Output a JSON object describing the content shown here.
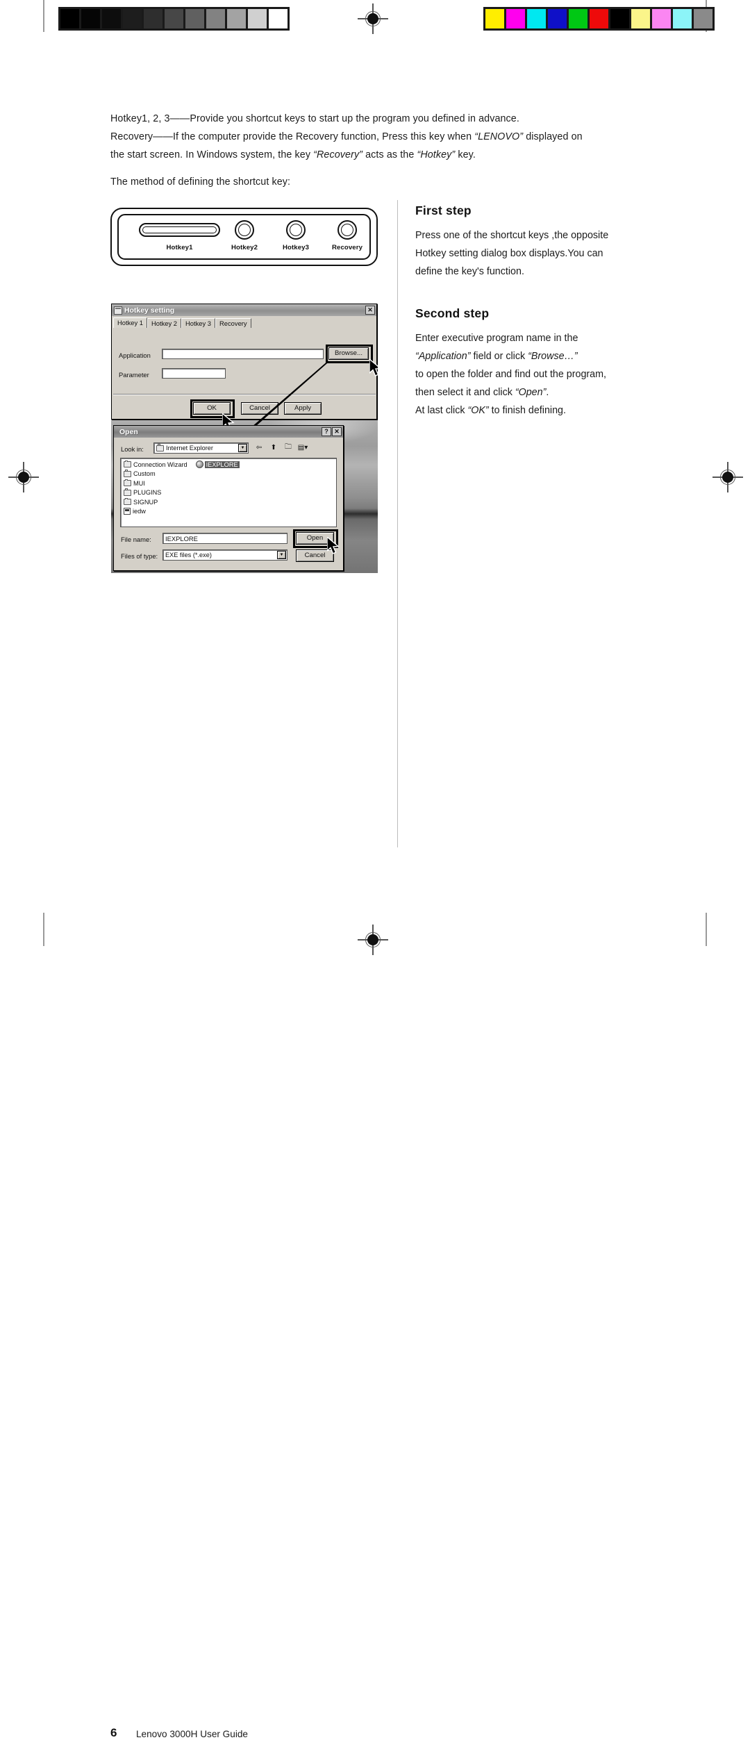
{
  "print_marks": {
    "grayscale_patches": [
      "#000000",
      "#050505",
      "#0d0d0d",
      "#1d1d1d",
      "#2e2e2e",
      "#474747",
      "#606060",
      "#828282",
      "#a3a3a3",
      "#d0d0d0",
      "#ffffff"
    ],
    "color_patches": [
      "#ffee00",
      "#ff00ee",
      "#00e8f0",
      "#0f10c8",
      "#00c814",
      "#ee0a0a",
      "#000000",
      "#fbf58a",
      "#fb86f2",
      "#8cf4f8",
      "#8a8a8a"
    ],
    "registration_mark_name": "registration-target"
  },
  "body": {
    "paragraph_1": "Hotkey1, 2, 3——Provide you shortcut keys to start up the program you defined in advance.",
    "paragraph_2_pre": "Recovery——If the computer provide the Recovery function, Press this key when ",
    "paragraph_2_em1": "“LENOVO”",
    "paragraph_2_mid": " displayed on",
    "paragraph_3_pre": "the start screen. In Windows system, the key ",
    "paragraph_3_em1": "“Recovery”",
    "paragraph_3_mid": " acts as the ",
    "paragraph_3_em2": "“Hotkey”",
    "paragraph_3_post": " key.",
    "paragraph_4": "The method of defining the shortcut key:"
  },
  "hotkey_panel": {
    "keys": [
      {
        "label": "Hotkey1",
        "shape": "long"
      },
      {
        "label": "Hotkey2",
        "shape": "round"
      },
      {
        "label": "Hotkey3",
        "shape": "round"
      },
      {
        "label": "Recovery",
        "shape": "round"
      }
    ]
  },
  "steps": [
    {
      "heading": "First step",
      "lines": [
        "Press one of the shortcut keys ,the opposite",
        "Hotkey setting dialog box displays.You can",
        "define the key's function."
      ]
    },
    {
      "heading": "Second step",
      "line_1": "Enter executive program  name in the",
      "line_2_em1": "“Application”",
      "line_2_mid": " field or click ",
      "line_2_em2": "“Browse…”",
      "line_3": "to open the folder and find out the program,",
      "line_4_pre": "then select it and click ",
      "line_4_em": "“Open”",
      "line_4_post": ".",
      "line_5_pre": "At last click ",
      "line_5_em": "“OK”",
      "line_5_post": " to finish defining."
    }
  ],
  "hotkey_dialog": {
    "title": "Hotkey setting",
    "close_label": "✕",
    "tabs": [
      "Hotkey 1",
      "Hotkey 2",
      "Hotkey 3",
      "Recovery"
    ],
    "active_tab": "Hotkey 1",
    "application_label": "Application",
    "application_value": "",
    "parameter_label": "Parameter",
    "parameter_value": "",
    "browse_label": "Browse...",
    "ok_label": "OK",
    "cancel_label": "Cancel",
    "apply_label": "Apply"
  },
  "open_dialog": {
    "title": "Open",
    "help_label": "?",
    "close_label": "✕",
    "look_in_label": "Look in:",
    "look_in_value": "Internet Explorer",
    "toolbar_icons": [
      "back-icon",
      "up-one-level-icon",
      "new-folder-icon",
      "views-icon"
    ],
    "items": [
      {
        "name": "Connection Wizard",
        "icon": "folder-icon",
        "selected": false
      },
      {
        "name": "IEXPLORE",
        "icon": "internet-explorer-icon",
        "selected": true
      },
      {
        "name": "Custom",
        "icon": "folder-icon",
        "selected": false
      },
      {
        "name": "MUI",
        "icon": "folder-icon",
        "selected": false
      },
      {
        "name": "PLUGINS",
        "icon": "folder-icon",
        "selected": false
      },
      {
        "name": "SIGNUP",
        "icon": "folder-icon",
        "selected": false
      },
      {
        "name": "iedw",
        "icon": "file-icon",
        "selected": false
      }
    ],
    "file_name_label": "File name:",
    "file_name_value": "IEXPLORE",
    "files_of_type_label": "Files of type:",
    "files_of_type_value": "EXE files (*.exe)",
    "open_label": "Open",
    "cancel_label": "Cancel"
  },
  "footer": {
    "page_number": "6",
    "book_title": "Lenovo 3000H User Guide"
  }
}
